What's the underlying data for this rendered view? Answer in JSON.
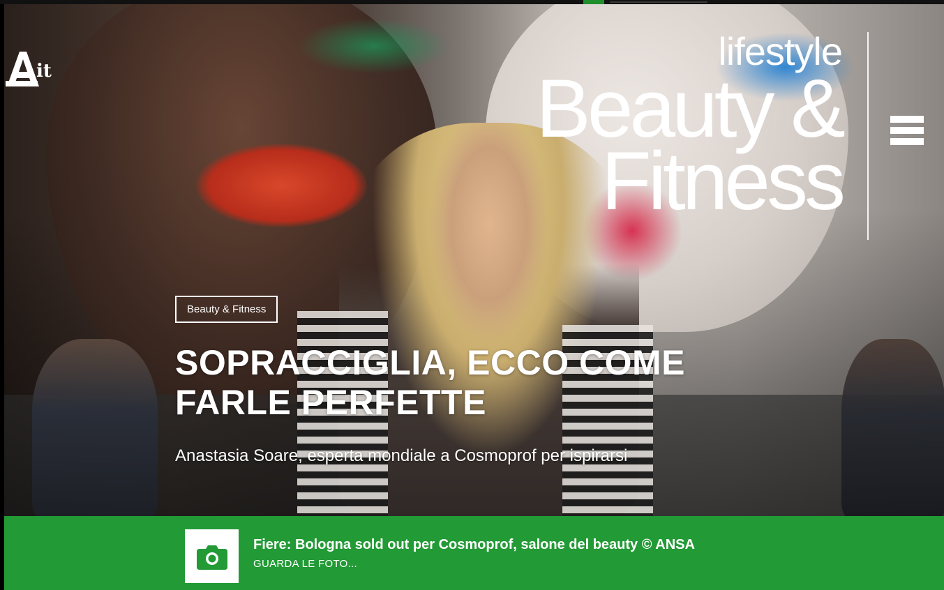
{
  "site": {
    "logo_text": "Ait"
  },
  "section": {
    "kicker": "lifestyle",
    "title_line1": "Beauty &",
    "title_line2": "Fitness"
  },
  "menu": {
    "icon": "hamburger-menu-icon"
  },
  "article": {
    "category": "Beauty & Fitness",
    "headline": "SOPRACCIGLIA, ECCO COME FARLE PERFETTE",
    "subtitle": "Anastasia Soare, esperta mondiale a Cosmoprof per ispirarsi"
  },
  "gallery": {
    "icon": "camera-icon",
    "caption": "Fiere: Bologna sold out per Cosmoprof, salone del beauty © ANSA",
    "link_label": "GUARDA LE FOTO..."
  },
  "colors": {
    "accent_green": "#229a35",
    "text_white": "#ffffff"
  }
}
